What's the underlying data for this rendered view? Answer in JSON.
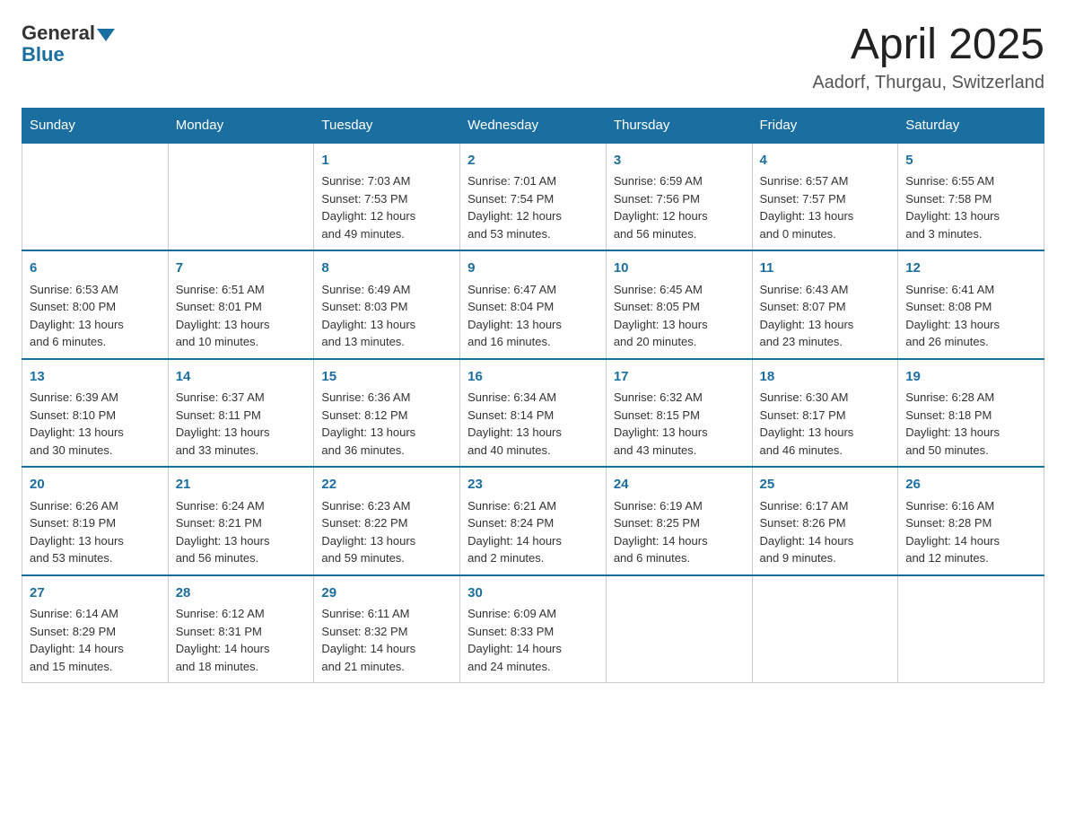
{
  "logo": {
    "general": "General",
    "blue": "Blue"
  },
  "header": {
    "title": "April 2025",
    "subtitle": "Aadorf, Thurgau, Switzerland"
  },
  "weekdays": [
    "Sunday",
    "Monday",
    "Tuesday",
    "Wednesday",
    "Thursday",
    "Friday",
    "Saturday"
  ],
  "weeks": [
    [
      {
        "day": "",
        "info": ""
      },
      {
        "day": "",
        "info": ""
      },
      {
        "day": "1",
        "info": "Sunrise: 7:03 AM\nSunset: 7:53 PM\nDaylight: 12 hours\nand 49 minutes."
      },
      {
        "day": "2",
        "info": "Sunrise: 7:01 AM\nSunset: 7:54 PM\nDaylight: 12 hours\nand 53 minutes."
      },
      {
        "day": "3",
        "info": "Sunrise: 6:59 AM\nSunset: 7:56 PM\nDaylight: 12 hours\nand 56 minutes."
      },
      {
        "day": "4",
        "info": "Sunrise: 6:57 AM\nSunset: 7:57 PM\nDaylight: 13 hours\nand 0 minutes."
      },
      {
        "day": "5",
        "info": "Sunrise: 6:55 AM\nSunset: 7:58 PM\nDaylight: 13 hours\nand 3 minutes."
      }
    ],
    [
      {
        "day": "6",
        "info": "Sunrise: 6:53 AM\nSunset: 8:00 PM\nDaylight: 13 hours\nand 6 minutes."
      },
      {
        "day": "7",
        "info": "Sunrise: 6:51 AM\nSunset: 8:01 PM\nDaylight: 13 hours\nand 10 minutes."
      },
      {
        "day": "8",
        "info": "Sunrise: 6:49 AM\nSunset: 8:03 PM\nDaylight: 13 hours\nand 13 minutes."
      },
      {
        "day": "9",
        "info": "Sunrise: 6:47 AM\nSunset: 8:04 PM\nDaylight: 13 hours\nand 16 minutes."
      },
      {
        "day": "10",
        "info": "Sunrise: 6:45 AM\nSunset: 8:05 PM\nDaylight: 13 hours\nand 20 minutes."
      },
      {
        "day": "11",
        "info": "Sunrise: 6:43 AM\nSunset: 8:07 PM\nDaylight: 13 hours\nand 23 minutes."
      },
      {
        "day": "12",
        "info": "Sunrise: 6:41 AM\nSunset: 8:08 PM\nDaylight: 13 hours\nand 26 minutes."
      }
    ],
    [
      {
        "day": "13",
        "info": "Sunrise: 6:39 AM\nSunset: 8:10 PM\nDaylight: 13 hours\nand 30 minutes."
      },
      {
        "day": "14",
        "info": "Sunrise: 6:37 AM\nSunset: 8:11 PM\nDaylight: 13 hours\nand 33 minutes."
      },
      {
        "day": "15",
        "info": "Sunrise: 6:36 AM\nSunset: 8:12 PM\nDaylight: 13 hours\nand 36 minutes."
      },
      {
        "day": "16",
        "info": "Sunrise: 6:34 AM\nSunset: 8:14 PM\nDaylight: 13 hours\nand 40 minutes."
      },
      {
        "day": "17",
        "info": "Sunrise: 6:32 AM\nSunset: 8:15 PM\nDaylight: 13 hours\nand 43 minutes."
      },
      {
        "day": "18",
        "info": "Sunrise: 6:30 AM\nSunset: 8:17 PM\nDaylight: 13 hours\nand 46 minutes."
      },
      {
        "day": "19",
        "info": "Sunrise: 6:28 AM\nSunset: 8:18 PM\nDaylight: 13 hours\nand 50 minutes."
      }
    ],
    [
      {
        "day": "20",
        "info": "Sunrise: 6:26 AM\nSunset: 8:19 PM\nDaylight: 13 hours\nand 53 minutes."
      },
      {
        "day": "21",
        "info": "Sunrise: 6:24 AM\nSunset: 8:21 PM\nDaylight: 13 hours\nand 56 minutes."
      },
      {
        "day": "22",
        "info": "Sunrise: 6:23 AM\nSunset: 8:22 PM\nDaylight: 13 hours\nand 59 minutes."
      },
      {
        "day": "23",
        "info": "Sunrise: 6:21 AM\nSunset: 8:24 PM\nDaylight: 14 hours\nand 2 minutes."
      },
      {
        "day": "24",
        "info": "Sunrise: 6:19 AM\nSunset: 8:25 PM\nDaylight: 14 hours\nand 6 minutes."
      },
      {
        "day": "25",
        "info": "Sunrise: 6:17 AM\nSunset: 8:26 PM\nDaylight: 14 hours\nand 9 minutes."
      },
      {
        "day": "26",
        "info": "Sunrise: 6:16 AM\nSunset: 8:28 PM\nDaylight: 14 hours\nand 12 minutes."
      }
    ],
    [
      {
        "day": "27",
        "info": "Sunrise: 6:14 AM\nSunset: 8:29 PM\nDaylight: 14 hours\nand 15 minutes."
      },
      {
        "day": "28",
        "info": "Sunrise: 6:12 AM\nSunset: 8:31 PM\nDaylight: 14 hours\nand 18 minutes."
      },
      {
        "day": "29",
        "info": "Sunrise: 6:11 AM\nSunset: 8:32 PM\nDaylight: 14 hours\nand 21 minutes."
      },
      {
        "day": "30",
        "info": "Sunrise: 6:09 AM\nSunset: 8:33 PM\nDaylight: 14 hours\nand 24 minutes."
      },
      {
        "day": "",
        "info": ""
      },
      {
        "day": "",
        "info": ""
      },
      {
        "day": "",
        "info": ""
      }
    ]
  ]
}
